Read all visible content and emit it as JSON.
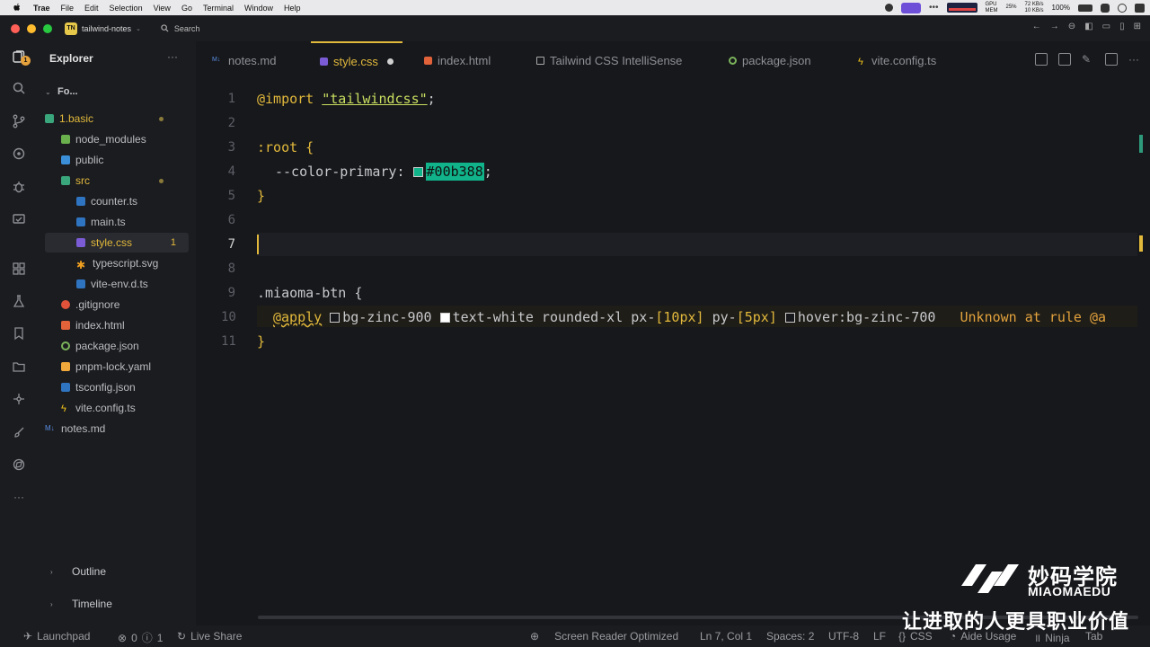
{
  "menubar": {
    "app": "Trae",
    "items": [
      "File",
      "Edit",
      "Selection",
      "View",
      "Go",
      "Terminal",
      "Window",
      "Help"
    ],
    "status": {
      "gpu_label": "GPU",
      "mem_label": "MEM",
      "mem_value": "25%",
      "net_up": "72 KB/s",
      "net_down": "10 KB/s",
      "battery": "100%"
    }
  },
  "titlebar": {
    "project_badge": "TN",
    "project_name": "tailwind-notes",
    "search_label": "Search"
  },
  "activity_badge": "1",
  "sidebar": {
    "title": "Explorer",
    "root_folder": "Fo...",
    "tree": [
      {
        "label": "1.basic",
        "kind": "folder-open",
        "modified": true
      },
      {
        "label": "node_modules",
        "kind": "folder"
      },
      {
        "label": "public",
        "kind": "folder"
      },
      {
        "label": "src",
        "kind": "folder-open",
        "modified": true
      },
      {
        "label": "counter.ts",
        "kind": "ts"
      },
      {
        "label": "main.ts",
        "kind": "ts"
      },
      {
        "label": "style.css",
        "kind": "css",
        "badge": "1",
        "active": true
      },
      {
        "label": "typescript.svg",
        "kind": "svg"
      },
      {
        "label": "vite-env.d.ts",
        "kind": "ts"
      },
      {
        "label": ".gitignore",
        "kind": "git"
      },
      {
        "label": "index.html",
        "kind": "html"
      },
      {
        "label": "package.json",
        "kind": "json"
      },
      {
        "label": "pnpm-lock.yaml",
        "kind": "yaml"
      },
      {
        "label": "tsconfig.json",
        "kind": "tsconfig"
      },
      {
        "label": "vite.config.ts",
        "kind": "vite"
      },
      {
        "label": "notes.md",
        "kind": "md"
      }
    ],
    "outline": "Outline",
    "timeline": "Timeline"
  },
  "tabs": [
    {
      "label": "notes.md",
      "icon": "markdown-icon"
    },
    {
      "label": "style.css",
      "icon": "css-icon",
      "active": true,
      "dirty": true
    },
    {
      "label": "index.html",
      "icon": "html-icon"
    },
    {
      "label": "Tailwind CSS IntelliSense",
      "icon": "extension-icon"
    },
    {
      "label": "package.json",
      "icon": "json-icon"
    },
    {
      "label": "vite.config.ts",
      "icon": "vite-icon"
    }
  ],
  "editor": {
    "line_numbers": [
      "1",
      "2",
      "3",
      "4",
      "5",
      "6",
      "7",
      "8",
      "9",
      "10",
      "11"
    ],
    "current_line": "7",
    "import_kw": "@import",
    "import_str": "\"tailwindcss\"",
    "semicolon": ";",
    "root_selector": ":root {",
    "var_name": "--color-primary:",
    "var_value": "#00b388",
    "close_brace": "}",
    "btn_selector": ".miaoma-btn {",
    "apply_kw": "@apply",
    "apply_classes_1": "bg-zinc-900",
    "apply_classes_2": "text-white rounded-xl px-",
    "px_value": "[10px]",
    "py_prefix": " py-",
    "py_value": "[5px]",
    "apply_classes_3": "hover:bg-zinc-700",
    "inline_warning": "Unknown at rule @a",
    "swatch_primary": "#00b388"
  },
  "statusbar": {
    "launchpad": "Launchpad",
    "errors": "0",
    "warnings": "1",
    "live_share": "Live Share",
    "screen_reader": "Screen Reader Optimized",
    "position": "Ln 7, Col 1",
    "spaces": "Spaces: 2",
    "encoding": "UTF-8",
    "eol": "LF",
    "language": "CSS",
    "aide": "Aide Usage",
    "ninja": "Ninja",
    "tab": "Tab"
  },
  "watermark": {
    "brand_cn": "妙码学院",
    "brand_en": "MIAOMAEDU",
    "slogan": "让进取的人更具职业价值"
  }
}
